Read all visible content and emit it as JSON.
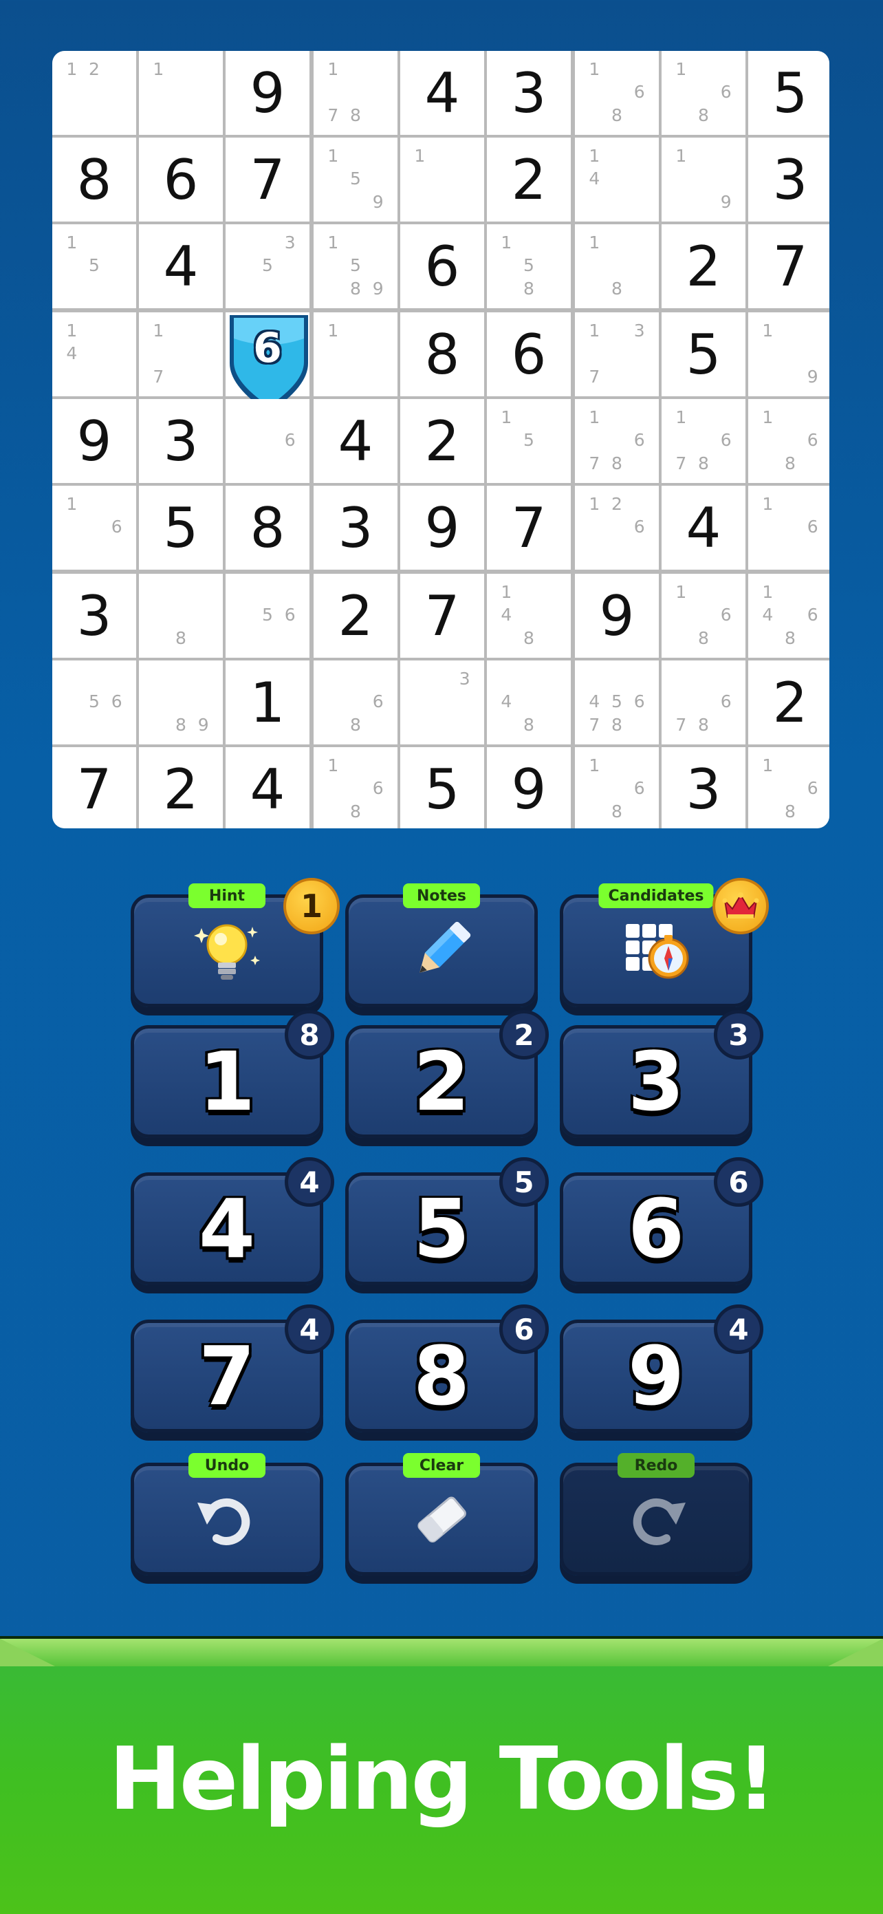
{
  "board": {
    "selected_digit": "6",
    "cells": [
      [
        {
          "n": "12"
        },
        {
          "n": "1"
        },
        {
          "v": "9"
        },
        {
          "n": "178"
        },
        {
          "v": "4"
        },
        {
          "v": "3"
        },
        {
          "n": "168"
        },
        {
          "n": "168"
        },
        {
          "v": "5"
        }
      ],
      [
        {
          "v": "8"
        },
        {
          "v": "6"
        },
        {
          "v": "7"
        },
        {
          "n": "159"
        },
        {
          "n": "1"
        },
        {
          "v": "2"
        },
        {
          "n": "14"
        },
        {
          "n": "19"
        },
        {
          "v": "3"
        }
      ],
      [
        {
          "n": "15"
        },
        {
          "v": "4"
        },
        {
          "n": "35"
        },
        {
          "n": "1589"
        },
        {
          "v": "6"
        },
        {
          "n": "158"
        },
        {
          "n": "18"
        },
        {
          "v": "2"
        },
        {
          "v": "7"
        }
      ],
      [
        {
          "n": "14"
        },
        {
          "n": "17"
        },
        {
          "v": "6",
          "selected": true
        },
        {
          "n": "1"
        },
        {
          "v": "8"
        },
        {
          "v": "6"
        },
        {
          "n": "137"
        },
        {
          "v": "5"
        },
        {
          "n": "19"
        }
      ],
      [
        {
          "v": "9"
        },
        {
          "v": "3"
        },
        {
          "n": "6"
        },
        {
          "v": "4"
        },
        {
          "v": "2"
        },
        {
          "n": "15"
        },
        {
          "n": "1678"
        },
        {
          "n": "1678"
        },
        {
          "n": "168"
        }
      ],
      [
        {
          "n": "16"
        },
        {
          "v": "5"
        },
        {
          "v": "8"
        },
        {
          "v": "3"
        },
        {
          "v": "9"
        },
        {
          "v": "7"
        },
        {
          "n": "126"
        },
        {
          "v": "4"
        },
        {
          "n": "16"
        }
      ],
      [
        {
          "v": "3"
        },
        {
          "n": "8"
        },
        {
          "n": "56"
        },
        {
          "v": "2"
        },
        {
          "v": "7"
        },
        {
          "n": "148"
        },
        {
          "v": "9"
        },
        {
          "n": "168"
        },
        {
          "n": "1468"
        }
      ],
      [
        {
          "n": "56"
        },
        {
          "n": "89"
        },
        {
          "v": "1"
        },
        {
          "n": "68"
        },
        {
          "n": "3"
        },
        {
          "n": "48"
        },
        {
          "n": "45678"
        },
        {
          "n": "678"
        },
        {
          "v": "2"
        }
      ],
      [
        {
          "v": "7"
        },
        {
          "v": "2"
        },
        {
          "v": "4"
        },
        {
          "n": "168"
        },
        {
          "v": "5"
        },
        {
          "v": "9"
        },
        {
          "n": "168"
        },
        {
          "v": "3"
        },
        {
          "n": "168"
        }
      ]
    ]
  },
  "tools": {
    "hint": {
      "label": "Hint",
      "count": "1",
      "icon": "lightbulb-icon"
    },
    "notes": {
      "label": "Notes",
      "icon": "pencil-icon"
    },
    "candidates": {
      "label": "Candidates",
      "icon": "candidates-grid-icon",
      "badge_icon": "crown-icon"
    },
    "undo": {
      "label": "Undo",
      "icon": "undo-arrow-icon"
    },
    "clear": {
      "label": "Clear",
      "icon": "eraser-icon"
    },
    "redo": {
      "label": "Redo",
      "icon": "redo-arrow-icon"
    }
  },
  "numpad": [
    {
      "digit": "1",
      "remaining": "8"
    },
    {
      "digit": "2",
      "remaining": "2"
    },
    {
      "digit": "3",
      "remaining": "3"
    },
    {
      "digit": "4",
      "remaining": "4"
    },
    {
      "digit": "5",
      "remaining": "5"
    },
    {
      "digit": "6",
      "remaining": "6"
    },
    {
      "digit": "7",
      "remaining": "4"
    },
    {
      "digit": "8",
      "remaining": "6"
    },
    {
      "digit": "9",
      "remaining": "4"
    }
  ],
  "banner": {
    "text": "Helping Tools!"
  },
  "colors": {
    "background": "#0a5ea4",
    "shield": "#2fb8e8",
    "tag_green": "#7bff2e",
    "banner_green": "#3fbf22"
  }
}
